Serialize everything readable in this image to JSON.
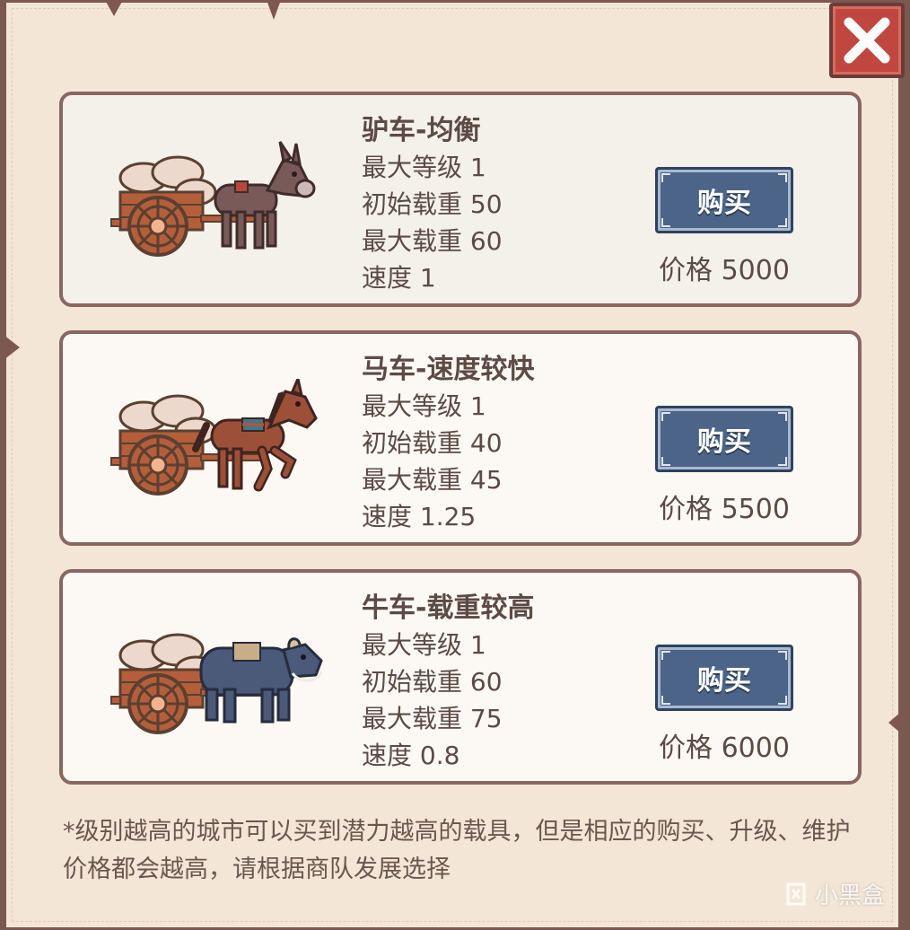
{
  "close_icon": "close-x-icon",
  "vehicles": [
    {
      "title": "驴车-均衡",
      "animal": "donkey",
      "stats": [
        "最大等级 1",
        "初始载重 50",
        "最大载重 60",
        "速度 1"
      ],
      "buy_label": "购买",
      "price": "价格 5000"
    },
    {
      "title": "马车-速度较快",
      "animal": "horse",
      "stats": [
        "最大等级 1",
        "初始载重 40",
        "最大载重 45",
        "速度 1.25"
      ],
      "buy_label": "购买",
      "price": "价格 5500"
    },
    {
      "title": "牛车-载重较高",
      "animal": "ox",
      "stats": [
        "最大等级 1",
        "初始载重 60",
        "最大载重 75",
        "速度 0.8"
      ],
      "buy_label": "购买",
      "price": "价格 6000"
    }
  ],
  "note": "*级别越高的城市可以买到潜力越高的载具，但是相应的购买、升级、维护价格都会越高，请根据商队发展选择",
  "watermark": "小黑盒",
  "colors": {
    "parchment": "#f4e6d6",
    "card_border": "#8a6660",
    "button_blue": "#4b6488",
    "close_red": "#c0473f",
    "text": "#5c4a44"
  }
}
